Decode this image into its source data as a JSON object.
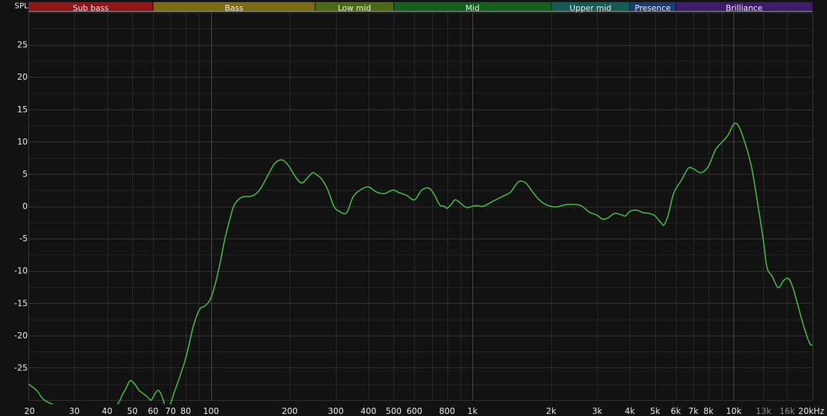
{
  "chart_data": {
    "type": "line",
    "ylabel": "SPL",
    "xscale": "log",
    "x_range_hz": [
      20,
      20000
    ],
    "ylim": [
      -30,
      30
    ],
    "grid": true,
    "y_ticks": [
      25,
      20,
      15,
      10,
      5,
      0,
      -5,
      -10,
      -15,
      -20,
      -25
    ],
    "x_ticks": [
      {
        "hz": 20,
        "label": "20",
        "dim": false
      },
      {
        "hz": 30,
        "label": "30",
        "dim": false
      },
      {
        "hz": 40,
        "label": "40",
        "dim": false
      },
      {
        "hz": 50,
        "label": "50",
        "dim": false
      },
      {
        "hz": 60,
        "label": "60",
        "dim": false
      },
      {
        "hz": 70,
        "label": "70",
        "dim": false
      },
      {
        "hz": 80,
        "label": "80",
        "dim": false
      },
      {
        "hz": 100,
        "label": "100",
        "dim": false
      },
      {
        "hz": 200,
        "label": "200",
        "dim": false
      },
      {
        "hz": 300,
        "label": "300",
        "dim": false
      },
      {
        "hz": 400,
        "label": "400",
        "dim": false
      },
      {
        "hz": 500,
        "label": "500",
        "dim": false
      },
      {
        "hz": 600,
        "label": "600",
        "dim": false
      },
      {
        "hz": 800,
        "label": "800",
        "dim": false
      },
      {
        "hz": 1000,
        "label": "1k",
        "dim": false
      },
      {
        "hz": 2000,
        "label": "2k",
        "dim": false
      },
      {
        "hz": 3000,
        "label": "3k",
        "dim": false
      },
      {
        "hz": 4000,
        "label": "4k",
        "dim": false
      },
      {
        "hz": 5000,
        "label": "5k",
        "dim": false
      },
      {
        "hz": 6000,
        "label": "6k",
        "dim": false
      },
      {
        "hz": 7000,
        "label": "7k",
        "dim": false
      },
      {
        "hz": 8000,
        "label": "8k",
        "dim": false
      },
      {
        "hz": 10000,
        "label": "10k",
        "dim": false
      },
      {
        "hz": 13000,
        "label": "13k",
        "dim": true
      },
      {
        "hz": 16000,
        "label": "16k",
        "dim": true
      },
      {
        "hz": 20000,
        "label": "20kHz",
        "dim": false
      }
    ],
    "bands": [
      {
        "name": "Sub bass",
        "from_hz": 20,
        "to_hz": 60,
        "color": "#8e1518"
      },
      {
        "name": "Bass",
        "from_hz": 60,
        "to_hz": 250,
        "color": "#7d6a14"
      },
      {
        "name": "Low mid",
        "from_hz": 250,
        "to_hz": 500,
        "color": "#4b6a12"
      },
      {
        "name": "Mid",
        "from_hz": 500,
        "to_hz": 2000,
        "color": "#16611e"
      },
      {
        "name": "Upper mid",
        "from_hz": 2000,
        "to_hz": 4000,
        "color": "#155a55"
      },
      {
        "name": "Presence",
        "from_hz": 4000,
        "to_hz": 6000,
        "color": "#1b3a6e"
      },
      {
        "name": "Brilliance",
        "from_hz": 6000,
        "to_hz": 20000,
        "color": "#3e1c6a"
      }
    ],
    "colors": {
      "line": "#3fb140",
      "background": "#121212",
      "grid": "#2a2a2a",
      "grid_major": "#4a4a4a",
      "tick_text": "#e8e8e8",
      "tick_text_dim": "#8c8c8c",
      "band_text": "#eeeeee"
    },
    "series": [
      {
        "x": [
          20,
          21.5,
          23,
          26,
          30,
          36,
          43,
          46,
          47.5,
          49,
          51,
          53,
          55,
          57,
          59,
          61,
          63,
          65,
          67,
          70,
          72,
          75,
          80,
          85,
          88,
          91,
          95,
          99,
          103,
          108,
          113,
          118,
          122,
          127,
          133,
          139,
          147,
          155,
          165,
          175,
          185,
          193,
          200,
          210,
          222,
          235,
          245,
          255,
          265,
          280,
          295,
          310,
          330,
          350,
          375,
          400,
          425,
          445,
          465,
          495,
          525,
          560,
          600,
          640,
          680,
          710,
          750,
          780,
          800,
          830,
          860,
          900,
          950,
          1000,
          1050,
          1100,
          1200,
          1300,
          1400,
          1500,
          1600,
          1700,
          1800,
          1900,
          2000,
          2100,
          2250,
          2400,
          2600,
          2800,
          3000,
          3150,
          3300,
          3500,
          3700,
          3850,
          4000,
          4250,
          4500,
          4750,
          5000,
          5250,
          5400,
          5600,
          5900,
          6300,
          6700,
          7000,
          7500,
          8000,
          8500,
          9000,
          9500,
          10000,
          10400,
          11000,
          11700,
          12500,
          13000,
          13400,
          14000,
          14800,
          15500,
          16200,
          16800,
          17500,
          18500,
          19500,
          20000
        ],
        "y": [
          -27.5,
          -28.5,
          -30,
          -31,
          -32,
          -32.5,
          -31,
          -29,
          -28,
          -27,
          -27.5,
          -28.5,
          -29,
          -29.5,
          -30,
          -29,
          -28.5,
          -29.5,
          -31,
          -30.5,
          -29,
          -27,
          -23.5,
          -19,
          -17,
          -15.8,
          -15.4,
          -14.5,
          -12.5,
          -9,
          -5,
          -2,
          0,
          1,
          1.5,
          1.5,
          1.8,
          2.8,
          4.8,
          6.6,
          7.2,
          6.8,
          6,
          4.6,
          3.6,
          4.5,
          5.2,
          4.8,
          4.2,
          2.5,
          0,
          -0.8,
          -1,
          1.5,
          2.6,
          3,
          2.3,
          2,
          2,
          2.5,
          2.1,
          1.7,
          1,
          2.5,
          2.8,
          2,
          0.2,
          0,
          -0.3,
          0.3,
          1,
          0.5,
          -0.2,
          0,
          0.1,
          0,
          0.8,
          1.5,
          2.2,
          3.8,
          3.6,
          2.2,
          1,
          0.3,
          0,
          -0.1,
          0.2,
          0.3,
          0.1,
          -0.9,
          -1.4,
          -2,
          -1.8,
          -1.1,
          -1.3,
          -1.5,
          -0.8,
          -0.6,
          -1,
          -1.1,
          -1.5,
          -2.5,
          -2.9,
          -1.5,
          2.1,
          4,
          5.9,
          5.8,
          5.2,
          6.2,
          8.7,
          9.9,
          11,
          12.7,
          12.5,
          10,
          6,
          -1,
          -5.5,
          -9.5,
          -10.8,
          -12.6,
          -11.5,
          -11.2,
          -12.5,
          -15,
          -18.5,
          -21.2,
          -21.5
        ]
      }
    ]
  }
}
